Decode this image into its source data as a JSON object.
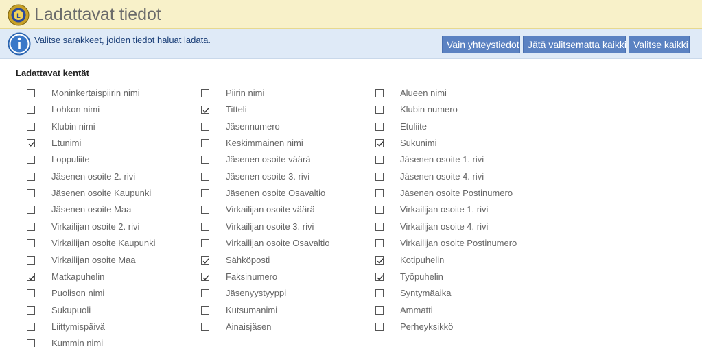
{
  "header": {
    "title": "Ladattavat tiedot",
    "logo_icon": "lions-logo-icon"
  },
  "info": {
    "icon": "info-icon",
    "text": "Valitse sarakkeet, joiden tiedot haluat ladata."
  },
  "actions": {
    "contacts_only": "Vain yhteystiedot",
    "deselect_all": "Jätä valitsematta kaikki",
    "select_all": "Valitse kaikki"
  },
  "fields_section": {
    "label": "Ladattavat kentät",
    "columns": [
      [
        {
          "label": "Moninkertaispiirin nimi",
          "checked": false
        },
        {
          "label": "Lohkon nimi",
          "checked": false
        },
        {
          "label": "Klubin nimi",
          "checked": false
        },
        {
          "label": "Etunimi",
          "checked": true
        },
        {
          "label": "Loppuliite",
          "checked": false
        },
        {
          "label": "Jäsenen osoite 2. rivi",
          "checked": false
        },
        {
          "label": "Jäsenen osoite Kaupunki",
          "checked": false
        },
        {
          "label": "Jäsenen osoite Maa",
          "checked": false
        },
        {
          "label": "Virkailijan osoite 2. rivi",
          "checked": false
        },
        {
          "label": "Virkailijan osoite Kaupunki",
          "checked": false
        },
        {
          "label": "Virkailijan osoite Maa",
          "checked": false
        },
        {
          "label": "Matkapuhelin",
          "checked": true
        },
        {
          "label": "Puolison nimi",
          "checked": false
        },
        {
          "label": "Sukupuoli",
          "checked": false
        },
        {
          "label": "Liittymispäivä",
          "checked": false
        },
        {
          "label": "Kummin nimi",
          "checked": false
        }
      ],
      [
        {
          "label": "Piirin nimi",
          "checked": false
        },
        {
          "label": "Titteli",
          "checked": true
        },
        {
          "label": "Jäsennumero",
          "checked": false
        },
        {
          "label": "Keskimmäinen nimi",
          "checked": false
        },
        {
          "label": "Jäsenen osoite väärä",
          "checked": false
        },
        {
          "label": "Jäsenen osoite 3. rivi",
          "checked": false
        },
        {
          "label": "Jäsenen osoite Osavaltio",
          "checked": false
        },
        {
          "label": "Virkailijan osoite väärä",
          "checked": false
        },
        {
          "label": "Virkailijan osoite 3. rivi",
          "checked": false
        },
        {
          "label": "Virkailijan osoite Osavaltio",
          "checked": false
        },
        {
          "label": "Sähköposti",
          "checked": true
        },
        {
          "label": "Faksinumero",
          "checked": true
        },
        {
          "label": "Jäsenyystyyppi",
          "checked": false
        },
        {
          "label": "Kutsumanimi",
          "checked": false
        },
        {
          "label": "Ainaisjäsen",
          "checked": false
        }
      ],
      [
        {
          "label": "Alueen nimi",
          "checked": false
        },
        {
          "label": "Klubin numero",
          "checked": false
        },
        {
          "label": "Etuliite",
          "checked": false
        },
        {
          "label": "Sukunimi",
          "checked": true
        },
        {
          "label": "Jäsenen osoite 1. rivi",
          "checked": false
        },
        {
          "label": "Jäsenen osoite 4. rivi",
          "checked": false
        },
        {
          "label": "Jäsenen osoite Postinumero",
          "checked": false
        },
        {
          "label": "Virkailijan osoite 1. rivi",
          "checked": false
        },
        {
          "label": "Virkailijan osoite 4. rivi",
          "checked": false
        },
        {
          "label": "Virkailijan osoite Postinumero",
          "checked": false
        },
        {
          "label": "Kotipuhelin",
          "checked": true
        },
        {
          "label": "Työpuhelin",
          "checked": true
        },
        {
          "label": "Syntymäaika",
          "checked": false
        },
        {
          "label": "Ammatti",
          "checked": false
        },
        {
          "label": "Perheyksikkö",
          "checked": false
        }
      ]
    ]
  },
  "colors": {
    "header_bg": "#f8f1c9",
    "info_bg": "#dfeaf7",
    "button_bg": "#5b82c2"
  }
}
